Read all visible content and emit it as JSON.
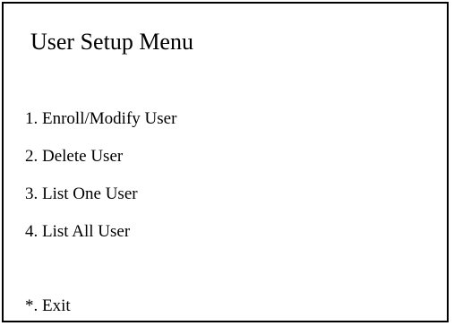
{
  "menu": {
    "title": "User Setup Menu",
    "options": [
      {
        "label": "1. Enroll/Modify User"
      },
      {
        "label": "2. Delete User"
      },
      {
        "label": "3. List One User"
      },
      {
        "label": "4. List All User"
      }
    ],
    "exit_label": "*. Exit"
  }
}
